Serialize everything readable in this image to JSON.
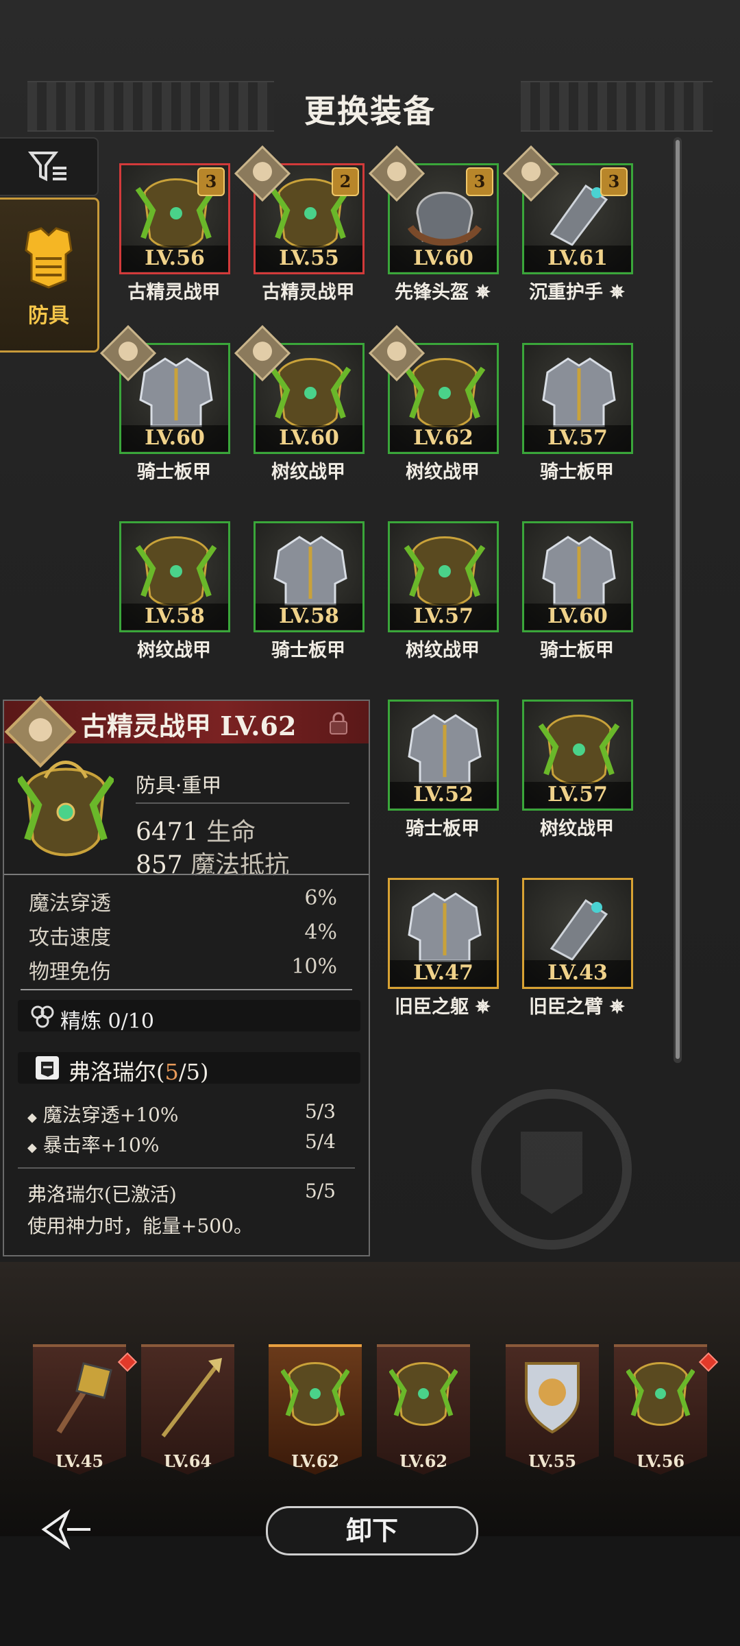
{
  "header": {
    "title": "更换装备"
  },
  "sidebar": {
    "armor_tab_label": "防具"
  },
  "items": [
    {
      "level": "LV.56",
      "name": "古精灵战甲",
      "border": "red",
      "count": "3",
      "owner": false
    },
    {
      "level": "LV.55",
      "name": "古精灵战甲",
      "border": "red",
      "count": "2",
      "owner": true
    },
    {
      "level": "LV.60",
      "name": "先锋头盔 ✵",
      "border": "green",
      "count": "3",
      "owner": true
    },
    {
      "level": "LV.61",
      "name": "沉重护手 ✵",
      "border": "green",
      "count": "3",
      "owner": true
    },
    {
      "level": "LV.60",
      "name": "骑士板甲",
      "border": "green",
      "count": "",
      "owner": true
    },
    {
      "level": "LV.60",
      "name": "树纹战甲",
      "border": "green",
      "count": "",
      "owner": true
    },
    {
      "level": "LV.62",
      "name": "树纹战甲",
      "border": "green",
      "count": "",
      "owner": true
    },
    {
      "level": "LV.57",
      "name": "骑士板甲",
      "border": "green",
      "count": "",
      "owner": false
    },
    {
      "level": "LV.58",
      "name": "树纹战甲",
      "border": "green",
      "count": "",
      "owner": false
    },
    {
      "level": "LV.58",
      "name": "骑士板甲",
      "border": "green",
      "count": "",
      "owner": false
    },
    {
      "level": "LV.57",
      "name": "树纹战甲",
      "border": "green",
      "count": "",
      "owner": false
    },
    {
      "level": "LV.60",
      "name": "骑士板甲",
      "border": "green",
      "count": "",
      "owner": false
    },
    {
      "level": "LV.52",
      "name": "骑士板甲",
      "border": "green",
      "count": "",
      "owner": false
    },
    {
      "level": "LV.57",
      "name": "树纹战甲",
      "border": "green",
      "count": "",
      "owner": false
    },
    {
      "level": "LV.47",
      "name": "旧臣之躯 ✵",
      "border": "gold",
      "count": "",
      "owner": false
    },
    {
      "level": "LV.43",
      "name": "旧臣之臂 ✵",
      "border": "gold",
      "count": "",
      "owner": false
    }
  ],
  "detail": {
    "title": "古精灵战甲 LV.62",
    "type": "防具·重甲",
    "main_stat_1_value": "6471",
    "main_stat_1_name": "生命",
    "main_stat_2_value": "857",
    "main_stat_2_name": "魔法抵抗",
    "substats": [
      {
        "name": "魔法穿透",
        "value": "6%"
      },
      {
        "name": "攻击速度",
        "value": "4%"
      },
      {
        "name": "物理免伤",
        "value": "10%"
      }
    ],
    "refine_label": "精炼 0/10",
    "set_name": "弗洛瑞尔",
    "set_progress_current": "5",
    "set_progress_suffix": "/5)",
    "set_bonuses": [
      {
        "text": "魔法穿透+10%",
        "value": "5/3"
      },
      {
        "text": "暴击率+10%",
        "value": "5/4"
      }
    ],
    "set_active_title": "弗洛瑞尔(已激活)",
    "set_active_value": "5/5",
    "set_active_desc": "使用神力时，能量+500。"
  },
  "equipped": [
    {
      "level": "LV.45",
      "kind": "mace",
      "gem": true
    },
    {
      "level": "LV.64",
      "kind": "spear",
      "gem": false
    },
    {
      "level": "LV.62",
      "kind": "elf-armor",
      "gem": false,
      "selected": true
    },
    {
      "level": "LV.62",
      "kind": "elf-armor",
      "gem": false
    },
    {
      "level": "LV.55",
      "kind": "lion-shield",
      "gem": false
    },
    {
      "level": "LV.56",
      "kind": "elf-armor",
      "gem": true
    }
  ],
  "footer": {
    "unequip_label": "卸下"
  },
  "colors": {
    "green": "#3aa63a",
    "red": "#d23a3a",
    "gold": "#d8a233",
    "accent": "#f5c64a"
  }
}
